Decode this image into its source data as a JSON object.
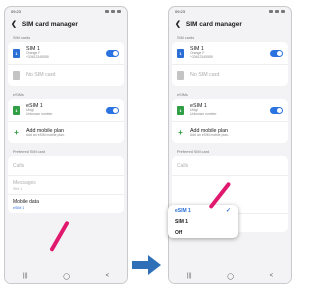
{
  "left": {
    "status_time": "09:23",
    "title": "SIM card manager",
    "sim_section": "SIM cards",
    "sim1_name": "SIM 1",
    "sim1_carrier": "Orange F",
    "sim1_number": "+33612345555",
    "nosim": "No SIM card",
    "esims_section": "eSIMs",
    "esim_name": "eSIM 1",
    "esim_carrier": "Ubigi",
    "esim_number": "Unknown number",
    "add_plan": "Add mobile plan",
    "add_plan_sub": "Add an eSIM mobile plan.",
    "pref_section": "Preferred SIM card",
    "calls": "Calls",
    "messages": "Messages",
    "messages_value": "SIM 1",
    "mobile_data": "Mobile data",
    "mobile_data_value": "eSIM 1",
    "nav": [
      "|||",
      "◯",
      "<"
    ]
  },
  "right": {
    "status_time": "09:23",
    "title": "SIM card manager",
    "sim_section": "SIM cards",
    "sim1_name": "SIM 1",
    "sim1_carrier": "Orange F",
    "sim1_number": "+33612345555",
    "nosim": "No SIM card",
    "esims_section": "eSIMs",
    "esim_name": "eSIM 1",
    "esim_carrier": "Ubigi",
    "esim_number": "Unknown number",
    "add_plan": "Add mobile plan",
    "add_plan_sub": "Add an eSIM mobile plan.",
    "pref_section": "Preferred SIM card",
    "calls": "Calls",
    "mobile_data": "Mobile data",
    "mobile_data_value": "eSIM 1",
    "nav": [
      "|||",
      "◯",
      "<"
    ]
  },
  "popup": {
    "options": [
      "eSIM 1",
      "SIM 1",
      "Off"
    ],
    "selected": "eSIM 1"
  },
  "colors": {
    "accent": "#2b73e0",
    "highlight_arrow": "#e0196e",
    "transition_arrow": "#2e6fb8"
  }
}
